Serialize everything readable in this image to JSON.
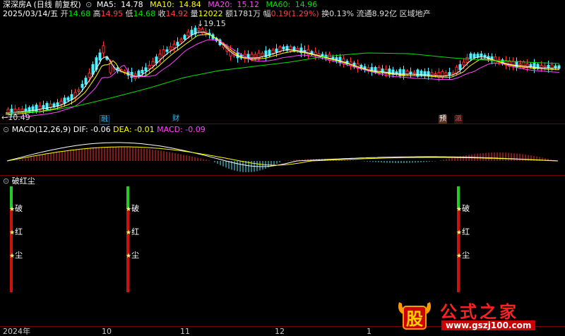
{
  "header": {
    "stock_name": "深深房A",
    "period": "(日线 前复权)",
    "ma_values": [
      {
        "label": "MA5:",
        "value": "14.78",
        "color": "#ffffff"
      },
      {
        "label": "MA10:",
        "value": "14.84",
        "color": "#ffff00"
      },
      {
        "label": "MA20:",
        "value": "15.12",
        "color": "#ff44ff"
      },
      {
        "label": "MA60:",
        "value": "14.96",
        "color": "#00e000"
      }
    ]
  },
  "quote": {
    "date": "2025/03/14/五",
    "open_label": "开",
    "open": "14.68",
    "high_label": "高",
    "high": "14.95",
    "low_label": "低",
    "low": "14.68",
    "close_label": "收",
    "close": "14.92",
    "volume_label": "量",
    "volume": "12022",
    "amount_label": "额",
    "amount": "1781万",
    "change_label": "幅",
    "change": "0.19(1.29%)",
    "turnover_label": "换",
    "turnover": "0.13%",
    "float_label": "流通",
    "float": "8.92亿",
    "sector": "区域地产"
  },
  "price_chart": {
    "high_marker": "19.15",
    "low_marker": "10.49",
    "event_flags": [
      "融",
      "财",
      "预",
      "派"
    ],
    "colors": {
      "up": "#ff3030",
      "down": "#4ff0ff",
      "ma5": "#ffffff",
      "ma10": "#ffff00",
      "ma20": "#ff44ff",
      "ma60": "#00e000"
    }
  },
  "macd": {
    "title": "MACD(12,26,9)",
    "dif_label": "DIF:",
    "dif": "-0.06",
    "dea_label": "DEA:",
    "dea": "-0.01",
    "macd_label": "MACD:",
    "macd": "-0.09"
  },
  "indicator": {
    "title": "破红尘",
    "chars": [
      "破",
      "红",
      "尘"
    ]
  },
  "date_axis": [
    "2024年",
    "10",
    "11",
    "12",
    "1"
  ],
  "watermark": {
    "stock_char": "股",
    "site_name": "公式之家",
    "url": "www.gszj100.com"
  }
}
